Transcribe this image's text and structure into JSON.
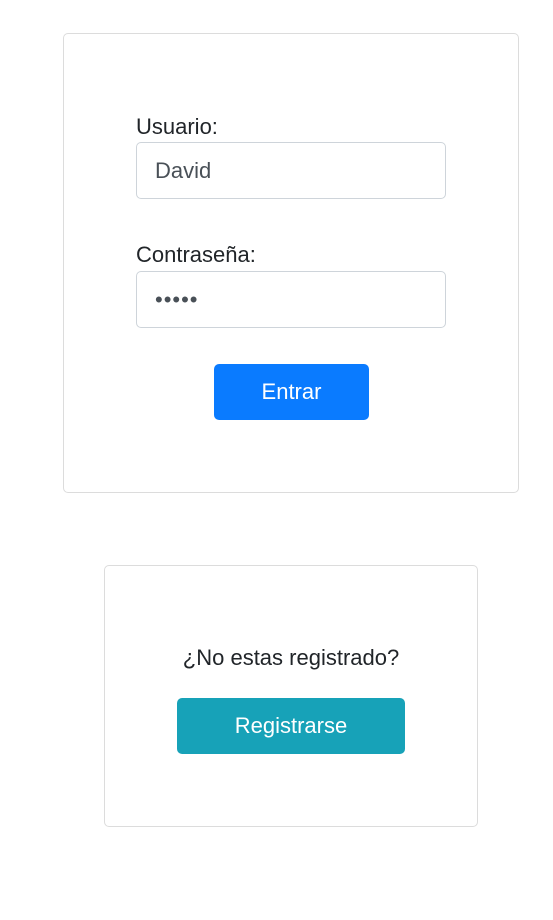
{
  "login": {
    "username_label": "Usuario:",
    "username_value": "David",
    "password_label": "Contraseña:",
    "password_value": "•••••",
    "submit_label": "Entrar"
  },
  "register": {
    "prompt": "¿No estas registrado?",
    "button_label": "Registrarse"
  },
  "colors": {
    "primary": "#0a7bff",
    "info": "#17a2b8",
    "border": "#dcdcdc"
  }
}
